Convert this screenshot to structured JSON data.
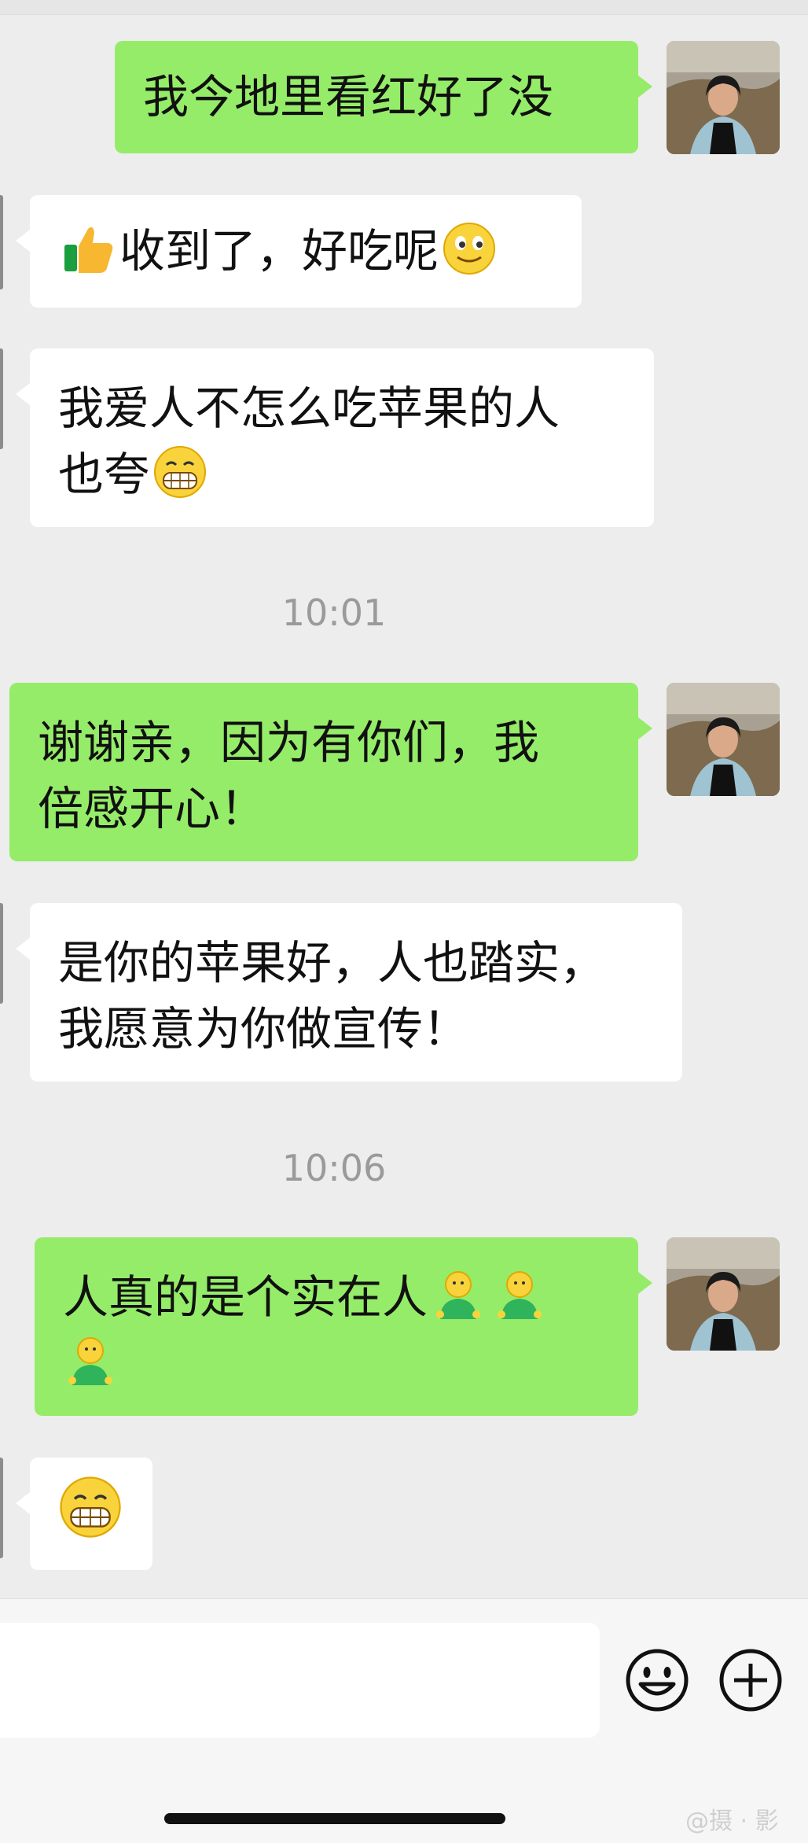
{
  "messages": [
    {
      "side": "right",
      "lines": [
        "我今地里看红好了没"
      ]
    },
    {
      "side": "left",
      "lines": [
        "收到了，好吃呢"
      ],
      "emoji_before": "thumbs-up-icon",
      "emoji_after": "smiling-face-icon"
    },
    {
      "side": "left",
      "lines": [
        "我爱人不怎么吃苹果的人",
        "也夸"
      ],
      "emoji_after": "grinning-face-icon"
    },
    {
      "side": "right",
      "lines": [
        "谢谢亲，因为有你们，我",
        "倍感开心！"
      ]
    },
    {
      "side": "left",
      "lines": [
        "是你的苹果好，人也踏实，",
        "我愿意为你做宣传！"
      ]
    },
    {
      "side": "right",
      "lines": [
        "人真的是个实在人",
        ""
      ],
      "emoji_after": "person-icon"
    },
    {
      "side": "left",
      "lines": [
        ""
      ],
      "emoji_after": "grinning-face-icon"
    }
  ],
  "timestamps": [
    "10:01",
    "10:06"
  ],
  "watermark": "@摄 · 影",
  "colors": {
    "green_bubble": "#95ec69",
    "white_bubble": "#ffffff",
    "background": "#ededed"
  }
}
